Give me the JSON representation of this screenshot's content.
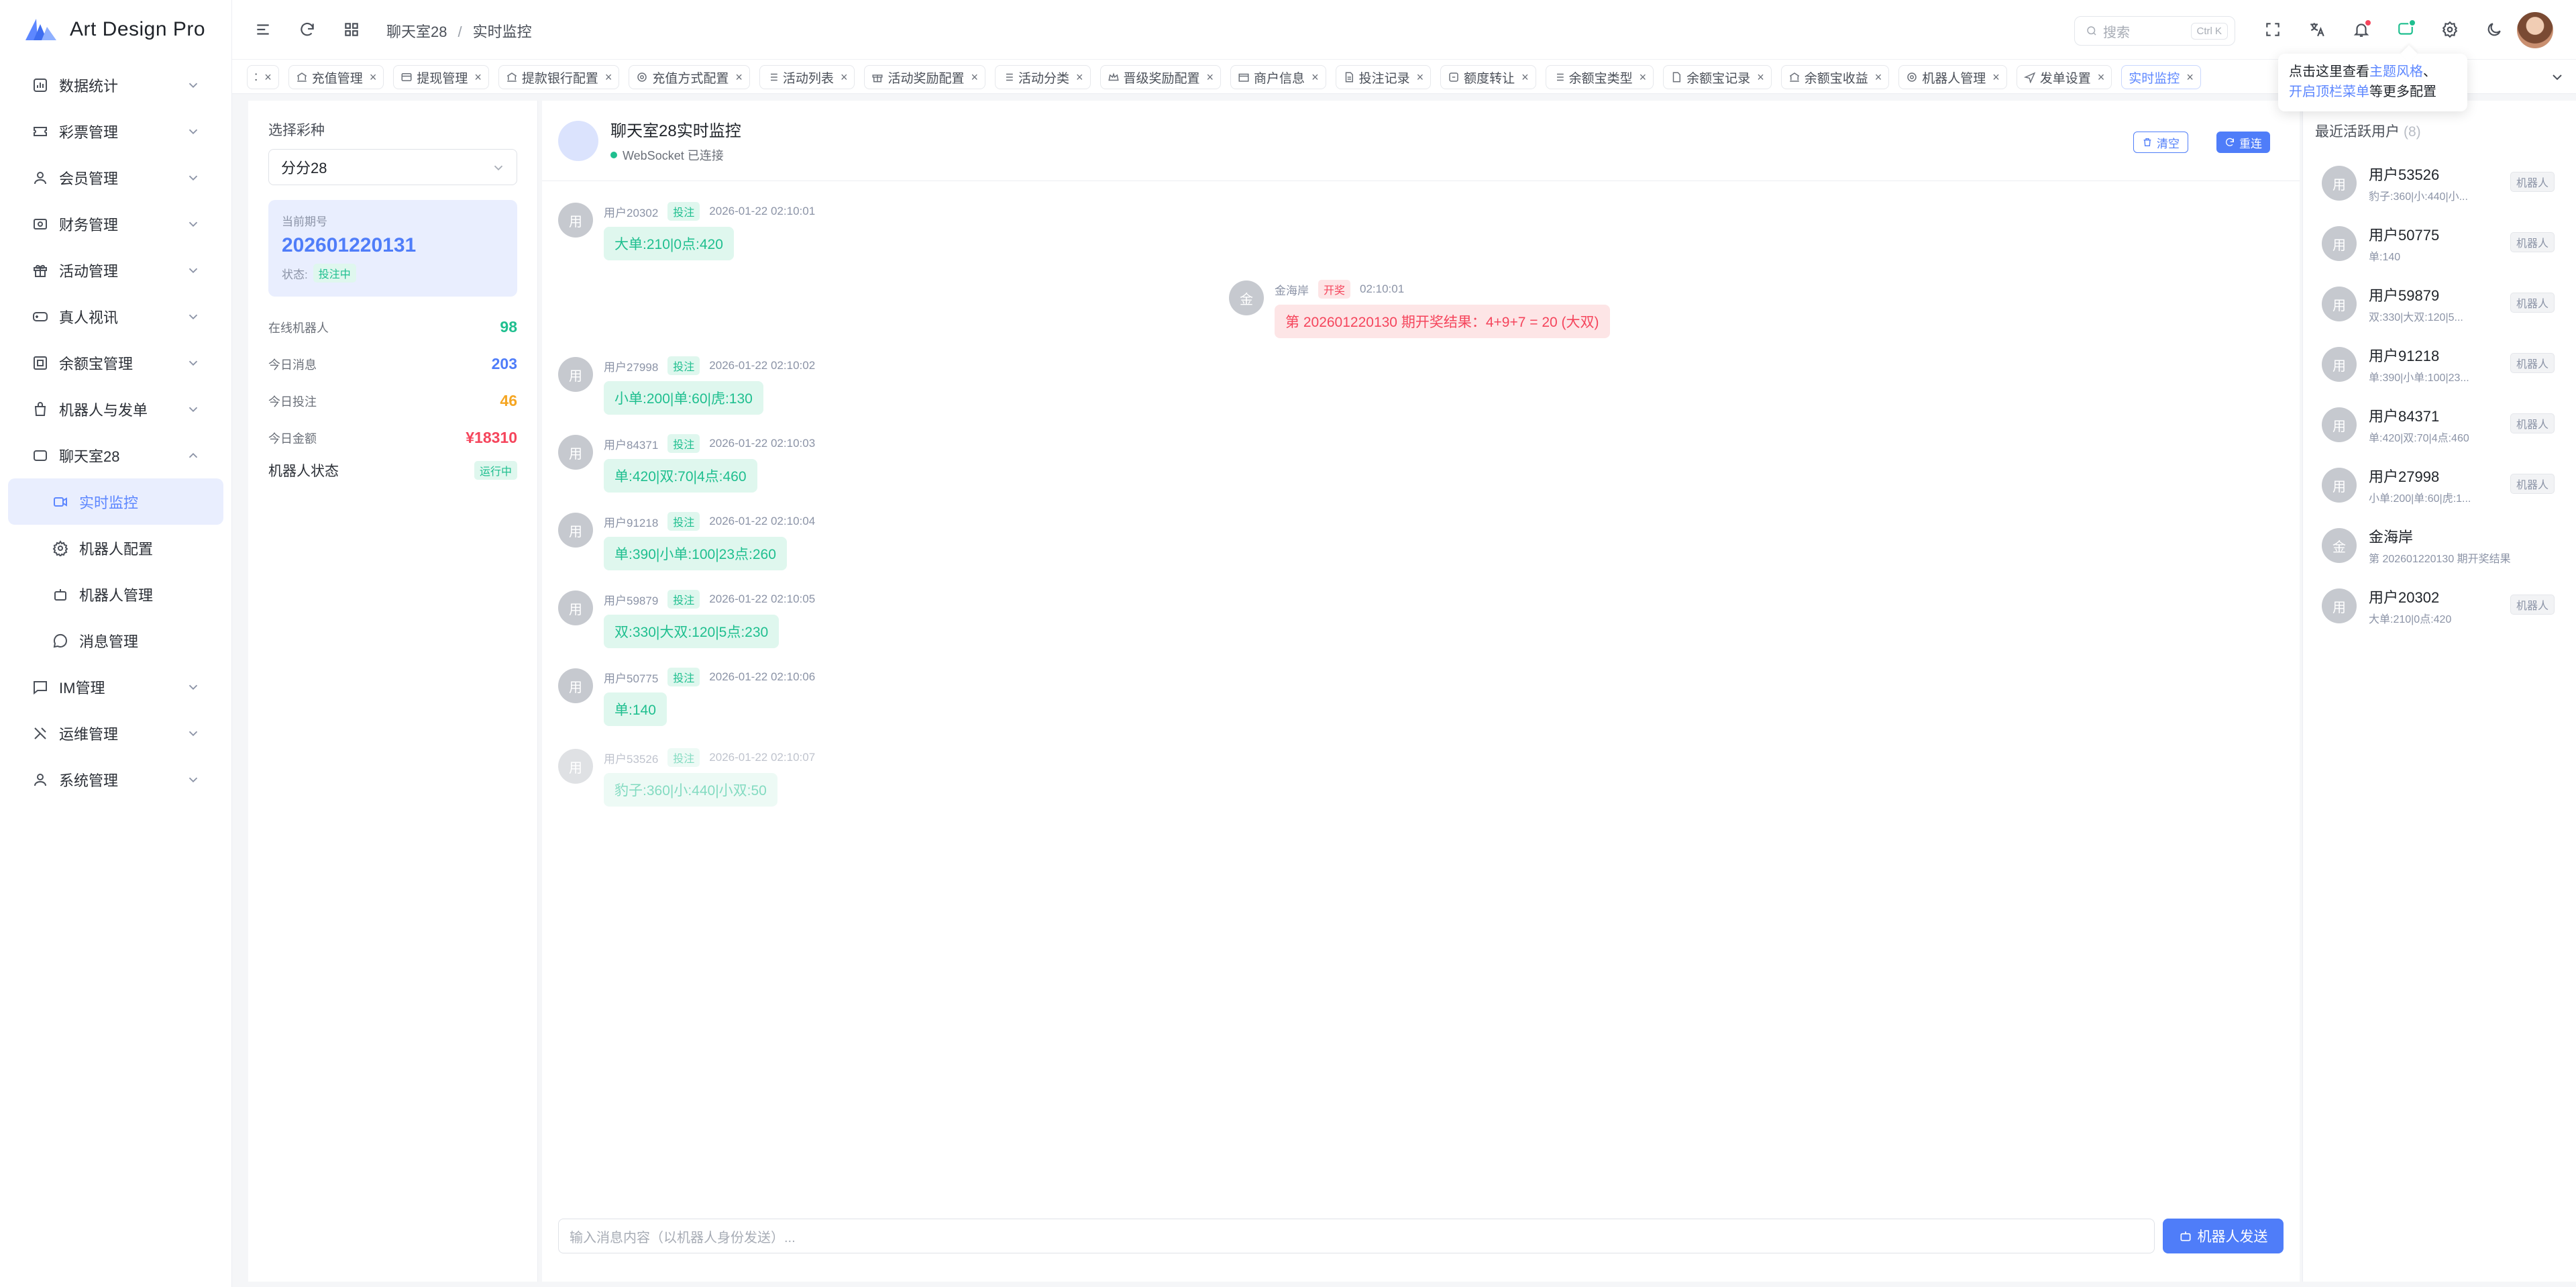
{
  "app": {
    "name": "Art Design Pro",
    "brand_color": "#5d87ff"
  },
  "sidebar": {
    "items": [
      {
        "label": "数据统计",
        "icon": "chart-bar-icon"
      },
      {
        "label": "彩票管理",
        "icon": "ticket-icon"
      },
      {
        "label": "会员管理",
        "icon": "user-icon"
      },
      {
        "label": "财务管理",
        "icon": "wallet-icon"
      },
      {
        "label": "活动管理",
        "icon": "gift-icon"
      },
      {
        "label": "真人视讯",
        "icon": "gamepad-icon"
      },
      {
        "label": "余额宝管理",
        "icon": "safe-icon"
      },
      {
        "label": "机器人与发单",
        "icon": "robot-bag-icon"
      },
      {
        "label": "聊天室28",
        "icon": "chat-room-icon",
        "expanded": true
      },
      {
        "label": "实时监控",
        "icon": "monitor-icon",
        "active": true
      },
      {
        "label": "机器人配置",
        "icon": "gear-icon"
      },
      {
        "label": "机器人管理",
        "icon": "robot-icon"
      },
      {
        "label": "消息管理",
        "icon": "message-icon"
      },
      {
        "label": "IM管理",
        "icon": "message-square-icon"
      },
      {
        "label": "运维管理",
        "icon": "tools-icon"
      },
      {
        "label": "系统管理",
        "icon": "user-cog-icon"
      }
    ]
  },
  "header": {
    "breadcrumb": [
      "聊天室28",
      "实时监控"
    ],
    "search_placeholder": "搜索",
    "search_shortcut": "Ctrl K"
  },
  "tabs": [
    "充值管理",
    "提现管理",
    "提款银行配置",
    "充值方式配置",
    "活动列表",
    "活动奖励配置",
    "活动分类",
    "晋级奖励配置",
    "商户信息",
    "投注记录",
    "额度转让",
    "余额宝类型",
    "余额宝记录",
    "余额宝收益",
    "机器人管理",
    "发单设置",
    "实时监控"
  ],
  "tooltip": {
    "prefix": "点击这里查看",
    "link1": "主题风格",
    "sep": "、",
    "link2": "开启顶栏菜单",
    "suffix": "等更多配置"
  },
  "left_panel": {
    "select_label": "选择彩种",
    "select_value": "分分28",
    "issue_label": "当前期号",
    "issue_number": "202601220131",
    "status_label": "状态:",
    "status_value": "投注中",
    "stats": [
      {
        "label": "在线机器人",
        "value": "98",
        "color": "#1fbf8f"
      },
      {
        "label": "今日消息",
        "value": "203",
        "color": "#4f7df9"
      },
      {
        "label": "今日投注",
        "value": "46",
        "color": "#f5a623"
      },
      {
        "label": "今日金额",
        "value": "¥18310",
        "color": "#f5455c"
      }
    ],
    "robot_status_label": "机器人状态",
    "robot_status_value": "运行中"
  },
  "chat": {
    "title": "聊天室28实时监控",
    "connection": "WebSocket 已连接",
    "clear_label": "清空",
    "reconnect_label": "重连",
    "messages": [
      {
        "avatar": "用",
        "user": "用户20302",
        "tag": "投注",
        "time": "2026-01-22 02:10:01",
        "text": "大单:210|0点:420"
      },
      {
        "avatar": "金",
        "user": "金海岸",
        "tag": "开奖",
        "time": "02:10:01",
        "text": "第 202601220130 期开奖结果：4+9+7 = 20 (大双)",
        "system": true
      },
      {
        "avatar": "用",
        "user": "用户27998",
        "tag": "投注",
        "time": "2026-01-22 02:10:02",
        "text": "小单:200|单:60|虎:130"
      },
      {
        "avatar": "用",
        "user": "用户84371",
        "tag": "投注",
        "time": "2026-01-22 02:10:03",
        "text": "单:420|双:70|4点:460"
      },
      {
        "avatar": "用",
        "user": "用户91218",
        "tag": "投注",
        "time": "2026-01-22 02:10:04",
        "text": "单:390|小单:100|23点:260"
      },
      {
        "avatar": "用",
        "user": "用户59879",
        "tag": "投注",
        "time": "2026-01-22 02:10:05",
        "text": "双:330|大双:120|5点:230"
      },
      {
        "avatar": "用",
        "user": "用户50775",
        "tag": "投注",
        "time": "2026-01-22 02:10:06",
        "text": "单:140"
      },
      {
        "avatar": "用",
        "user": "用户53526",
        "tag": "投注",
        "time": "2026-01-22 02:10:07",
        "text": "豹子:360|小:440|小双:50",
        "faded": true
      }
    ],
    "input_placeholder": "输入消息内容（以机器人身份发送）...",
    "send_label": "机器人发送"
  },
  "right_panel": {
    "title": "最近活跃用户",
    "count": "(8)",
    "users": [
      {
        "avatar": "用",
        "name": "用户53526",
        "desc": "豹子:360|小:440|小...",
        "tag": "机器人"
      },
      {
        "avatar": "用",
        "name": "用户50775",
        "desc": "单:140",
        "tag": "机器人"
      },
      {
        "avatar": "用",
        "name": "用户59879",
        "desc": "双:330|大双:120|5...",
        "tag": "机器人"
      },
      {
        "avatar": "用",
        "name": "用户91218",
        "desc": "单:390|小单:100|23...",
        "tag": "机器人"
      },
      {
        "avatar": "用",
        "name": "用户84371",
        "desc": "单:420|双:70|4点:460",
        "tag": "机器人"
      },
      {
        "avatar": "用",
        "name": "用户27998",
        "desc": "小单:200|单:60|虎:1...",
        "tag": "机器人"
      },
      {
        "avatar": "金",
        "name": "金海岸",
        "desc": "第 202601220130 期开奖结果",
        "tag": ""
      },
      {
        "avatar": "用",
        "name": "用户20302",
        "desc": "大单:210|0点:420",
        "tag": "机器人"
      }
    ]
  }
}
